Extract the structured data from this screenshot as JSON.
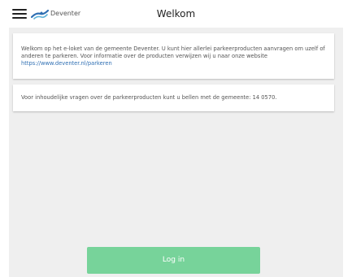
{
  "header": {
    "menu_icon": "hamburger-menu-icon",
    "logo_icon": "deventer-logo-icon",
    "logo_text": "Deventer",
    "title": "Welkom"
  },
  "cards": {
    "welcome_text": "Welkom op het e-loket van de gemeente Deventer. U kunt hier allerlei parkeerproducten aanvragen om uzelf of anderen te parkeren. Voor informatie over de producten verwijzen wij u naar onze website ",
    "welcome_link": "https://www.deventer.nl/parkeren",
    "contact_text": "Voor inhoudelijke vragen over de parkeerproducten kunt u bellen met de gemeente: 14 0570."
  },
  "actions": {
    "login_label": "Log in"
  },
  "colors": {
    "button": "#77d39a",
    "link": "#2f6fb3",
    "background": "#efefef"
  }
}
